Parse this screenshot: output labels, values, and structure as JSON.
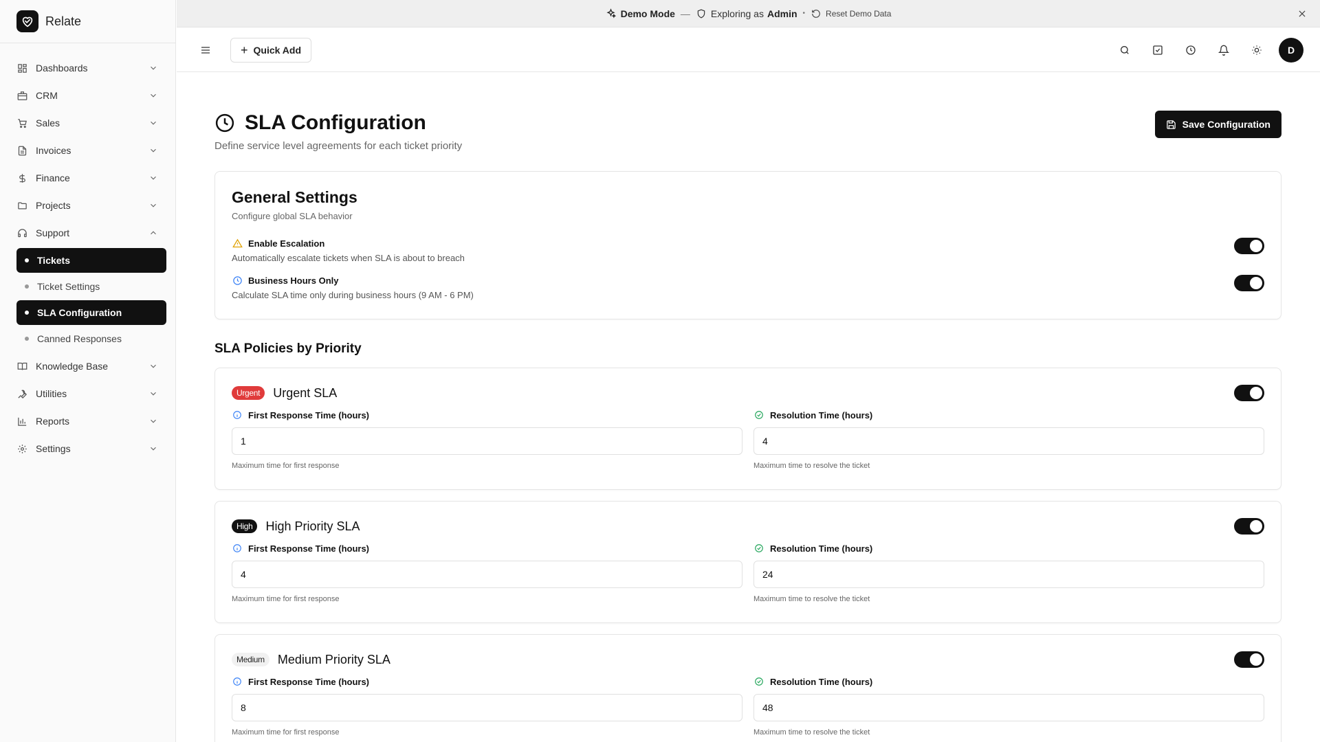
{
  "app": {
    "name": "Relate"
  },
  "sidebar": {
    "items": [
      {
        "label": "Dashboards",
        "icon": "dashboard-icon"
      },
      {
        "label": "CRM",
        "icon": "building-icon"
      },
      {
        "label": "Sales",
        "icon": "cart-icon"
      },
      {
        "label": "Invoices",
        "icon": "file-icon"
      },
      {
        "label": "Finance",
        "icon": "dollar-icon"
      },
      {
        "label": "Projects",
        "icon": "folder-icon"
      },
      {
        "label": "Support",
        "icon": "headset-icon",
        "expanded": true
      }
    ],
    "support_children": [
      {
        "label": "Tickets",
        "active": true
      },
      {
        "label": "Ticket Settings",
        "active": false
      },
      {
        "label": "SLA Configuration",
        "active": true
      },
      {
        "label": "Canned Responses",
        "active": false
      }
    ],
    "items_after": [
      {
        "label": "Knowledge Base",
        "icon": "book-icon"
      },
      {
        "label": "Utilities",
        "icon": "wrench-icon"
      },
      {
        "label": "Reports",
        "icon": "chart-icon"
      },
      {
        "label": "Settings",
        "icon": "gear-icon"
      }
    ]
  },
  "banner": {
    "mode": "Demo Mode",
    "exploring_prefix": "Exploring as",
    "role": "Admin",
    "reset": "Reset Demo Data"
  },
  "topbar": {
    "quick_add": "Quick Add",
    "avatar_initial": "D"
  },
  "page": {
    "title": "SLA Configuration",
    "subtitle": "Define service level agreements for each ticket priority",
    "save_label": "Save Configuration"
  },
  "general": {
    "title": "General Settings",
    "subtitle": "Configure global SLA behavior",
    "settings": [
      {
        "label": "Enable Escalation",
        "desc": "Automatically escalate tickets when SLA is about to breach",
        "enabled": true
      },
      {
        "label": "Business Hours Only",
        "desc": "Calculate SLA time only during business hours (9 AM - 6 PM)",
        "enabled": true
      }
    ]
  },
  "policies_title": "SLA Policies by Priority",
  "policies": [
    {
      "badge": "Urgent",
      "name": "Urgent SLA",
      "first_response": "1",
      "resolution": "4",
      "enabled": true
    },
    {
      "badge": "High",
      "name": "High Priority SLA",
      "first_response": "4",
      "resolution": "24",
      "enabled": true
    },
    {
      "badge": "Medium",
      "name": "Medium Priority SLA",
      "first_response": "8",
      "resolution": "48",
      "enabled": true
    }
  ],
  "fields": {
    "first_response_label": "First Response Time (hours)",
    "first_response_help": "Maximum time for first response",
    "resolution_label": "Resolution Time (hours)",
    "resolution_help": "Maximum time to resolve the ticket"
  },
  "colors": {
    "accent": "#111111",
    "urgent": "#e03b3b",
    "warning": "#e0a100",
    "info": "#3b82f6",
    "success": "#22a55a"
  }
}
